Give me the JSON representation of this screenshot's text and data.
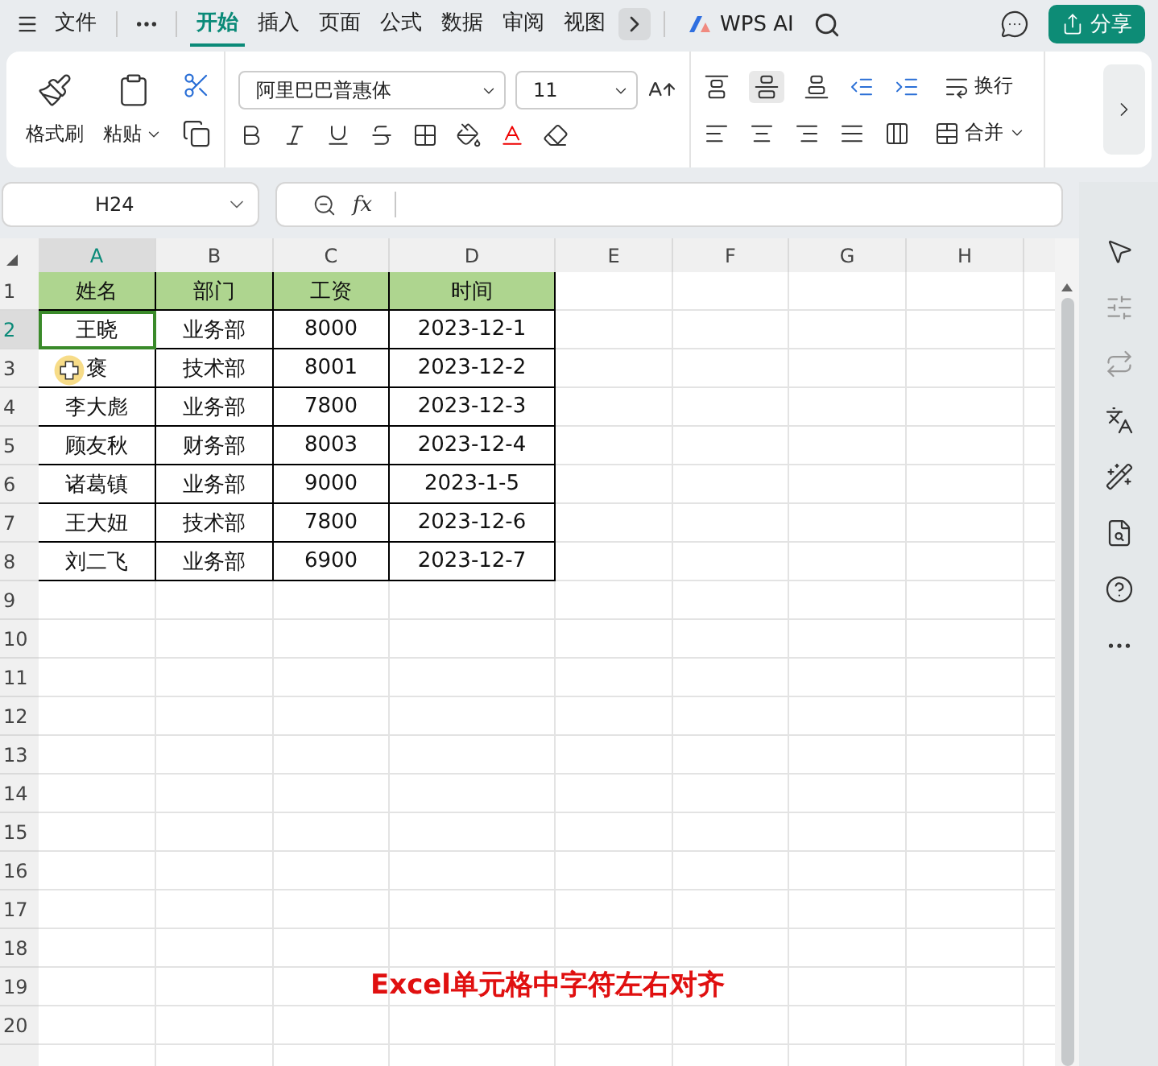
{
  "menu_tabs": [
    {
      "label": "文件",
      "selected": false
    },
    {
      "label": "开始",
      "selected": true
    },
    {
      "label": "插入",
      "selected": false
    },
    {
      "label": "页面",
      "selected": false
    },
    {
      "label": "公式",
      "selected": false
    },
    {
      "label": "数据",
      "selected": false
    },
    {
      "label": "审阅",
      "selected": false
    },
    {
      "label": "视图",
      "selected": false
    }
  ],
  "wps_ai": "WPS AI",
  "share": "分享",
  "ribbon": {
    "format_painter": "格式刷",
    "paste": "粘贴",
    "font": "阿里巴巴普惠体",
    "font_size": "11",
    "wrap": "换行",
    "merge": "合并"
  },
  "name_box": "H24",
  "formula_label": "fx",
  "sheet": {
    "columns": [
      {
        "label": "A",
        "selected": true
      },
      {
        "label": "B",
        "selected": false
      },
      {
        "label": "C",
        "selected": false
      },
      {
        "label": "D",
        "selected": false
      },
      {
        "label": "E",
        "selected": false
      },
      {
        "label": "F",
        "selected": false
      },
      {
        "label": "G",
        "selected": false
      },
      {
        "label": "H",
        "selected": false
      }
    ],
    "rows": [
      {
        "number": "1",
        "kind": "header",
        "selected": false,
        "cells": [
          {
            "text": "姓名",
            "selected": false
          },
          {
            "text": "部门",
            "selected": false
          },
          {
            "text": "工资",
            "selected": false
          },
          {
            "text": "时间",
            "selected": false
          }
        ]
      },
      {
        "number": "2",
        "kind": "data",
        "selected": true,
        "cells": [
          {
            "text": "王晓",
            "selected": true
          },
          {
            "text": "业务部",
            "selected": false
          },
          {
            "text": "8000",
            "selected": false
          },
          {
            "text": "2023-12-1",
            "selected": false
          }
        ]
      },
      {
        "number": "3",
        "kind": "data",
        "selected": false,
        "cells": [
          {
            "text": "褒",
            "selected": false
          },
          {
            "text": "技术部",
            "selected": false
          },
          {
            "text": "8001",
            "selected": false
          },
          {
            "text": "2023-12-2",
            "selected": false
          }
        ]
      },
      {
        "number": "4",
        "kind": "data",
        "selected": false,
        "cells": [
          {
            "text": "李大彪",
            "selected": false
          },
          {
            "text": "业务部",
            "selected": false
          },
          {
            "text": "7800",
            "selected": false
          },
          {
            "text": "2023-12-3",
            "selected": false
          }
        ]
      },
      {
        "number": "5",
        "kind": "data",
        "selected": false,
        "cells": [
          {
            "text": "顾友秋",
            "selected": false
          },
          {
            "text": "财务部",
            "selected": false
          },
          {
            "text": "8003",
            "selected": false
          },
          {
            "text": "2023-12-4",
            "selected": false
          }
        ]
      },
      {
        "number": "6",
        "kind": "data",
        "selected": false,
        "cells": [
          {
            "text": "诸葛镇",
            "selected": false
          },
          {
            "text": "业务部",
            "selected": false
          },
          {
            "text": "9000",
            "selected": false
          },
          {
            "text": "2023-1-5",
            "selected": false
          }
        ]
      },
      {
        "number": "7",
        "kind": "data",
        "selected": false,
        "cells": [
          {
            "text": "王大妞",
            "selected": false
          },
          {
            "text": "技术部",
            "selected": false
          },
          {
            "text": "7800",
            "selected": false
          },
          {
            "text": "2023-12-6",
            "selected": false
          }
        ]
      },
      {
        "number": "8",
        "kind": "data",
        "selected": false,
        "cells": [
          {
            "text": "刘二飞",
            "selected": false
          },
          {
            "text": "业务部",
            "selected": false
          },
          {
            "text": "6900",
            "selected": false
          },
          {
            "text": "2023-12-7",
            "selected": false
          }
        ]
      },
      {
        "number": "9",
        "selected": false
      },
      {
        "number": "10",
        "selected": false
      },
      {
        "number": "11",
        "selected": false
      },
      {
        "number": "12",
        "selected": false
      },
      {
        "number": "13",
        "selected": false
      },
      {
        "number": "14",
        "selected": false
      },
      {
        "number": "15",
        "selected": false
      },
      {
        "number": "16",
        "selected": false
      },
      {
        "number": "17",
        "selected": false
      },
      {
        "number": "18",
        "selected": false
      },
      {
        "number": "19",
        "selected": false
      },
      {
        "number": "20",
        "selected": false
      }
    ]
  },
  "caption": "Excel单元格中字符左右对齐"
}
